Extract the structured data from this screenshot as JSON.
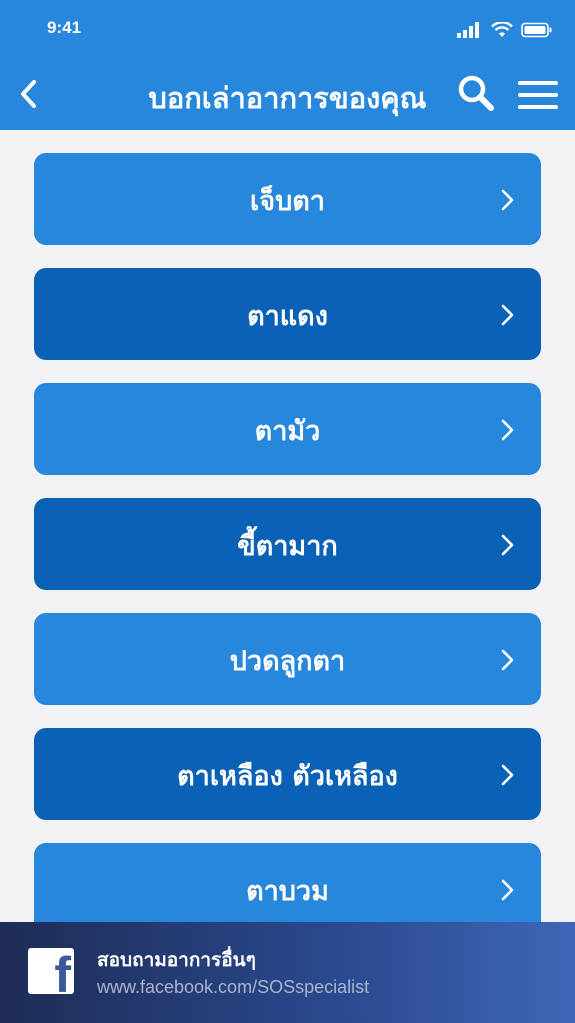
{
  "status_bar": {
    "time": "9:41"
  },
  "header": {
    "title": "บอกเล่าอาการของคุณ",
    "back_icon": "chevron-left-icon",
    "search_icon": "search-icon",
    "menu_icon": "hamburger-menu-icon"
  },
  "symptoms": [
    {
      "label": "เจ็บตา",
      "style": "light"
    },
    {
      "label": "ตาแดง",
      "style": "dark"
    },
    {
      "label": "ตามัว",
      "style": "light"
    },
    {
      "label": "ขี้ตามาก",
      "style": "dark"
    },
    {
      "label": "ปวดลูกตา",
      "style": "light"
    },
    {
      "label": "ตาเหลือง ตัวเหลือง",
      "style": "dark"
    },
    {
      "label": "ตาบวม",
      "style": "light"
    }
  ],
  "footer": {
    "title": "สอบถามอาการอื่นๆ",
    "url": "www.facebook.com/SOSspecialist",
    "logo_letter": "f"
  },
  "colors": {
    "header": "#2787dc",
    "item_light": "#2787dc",
    "item_dark": "#0a61b6",
    "background": "#f2f2f4",
    "footer_start": "#1e2c55",
    "footer_end": "#3f66b6"
  }
}
